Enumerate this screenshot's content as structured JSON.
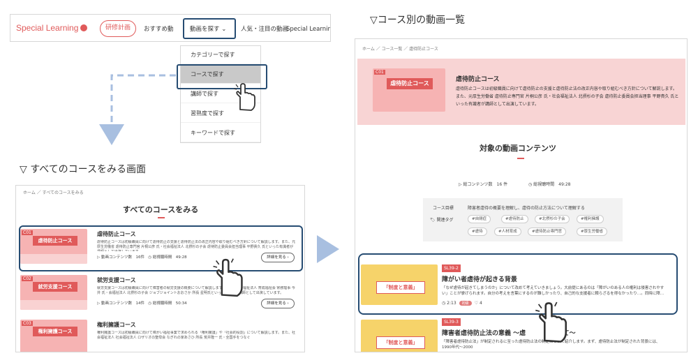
{
  "navbar": {
    "logo": "Special Learning",
    "pill": "研修計画",
    "items": [
      "おすすめ動",
      "動画を探す",
      "人気・注目の動画",
      "Special Learningとし"
    ]
  },
  "dropdown": {
    "items": [
      "カテゴリーで探す",
      "コースで探す",
      "講師で探す",
      "習熟度で探す",
      "キーワードで探す"
    ]
  },
  "headings": {
    "left": "▽ すべてのコースをみる画面",
    "right": "▽コース別の動画一覧"
  },
  "course_list": {
    "breadcrumb": "ホーム ／ すべてのコースをみる",
    "title": "すべてのコースをみる",
    "detail_label": "詳細を見る ›",
    "cards": [
      {
        "code": "C01",
        "thumb_title": "虐待防止コース",
        "title": "虐待防止コース",
        "desc": "虐待防止コースは初級職員に向けて虐待防止の支援と虐待防止法の改正内容や取り組むべき方針について解説します。また、元厚生労働省 虐待防止専門官 片桐公彦 氏・社会福祉法人 北摂杉の子会 虐待防止委員会担当理事 平野貴久 氏といった有識者が講師として出演しています。",
        "count": "動画コンテンツ数　16件",
        "time": "総視聴時間　49:28"
      },
      {
        "code": "C02",
        "thumb_title": "就労支援コース",
        "title": "就労支援コース",
        "desc": "就労支援コースは初級職員に向けて障害者の就労支援の概要について解説します。また、社会福祉法人 育成福祉会 常務理事 今井 氏・会福祉法人 北摂杉の子会 ジョブジョイントおおさか 所長 星明氏といった有識者が講師として出演しています。",
        "count": "動画コンテンツ数　14件",
        "time": "総視聴時間　50:34"
      },
      {
        "code": "C03",
        "thumb_title": "権利擁護コース",
        "title": "権利擁護コース",
        "desc": "権利擁護コースは初級職員に向けて障がい福祉事業で求められる「権利擁護」や「社会的役割」について解説します。また、社会福祉法人 社会福祉法人 ロザリオの聖母会 なぎれの家あさひ 所長 荒井隆一 氏・全国手をつなぐ",
        "count": "",
        "time": ""
      }
    ]
  },
  "course_detail": {
    "breadcrumb": "ホーム ／ コース一覧 ／ 虐待防止コース",
    "banner": {
      "code": "C01",
      "thumb_title": "虐待防止コース",
      "title": "虐待防止コース",
      "desc": "虐待防止コースは初級職員に向けて虐待防止の支援と虐待防止法の改正内容や取り組むべき方針について解説します。また、元厚生労働省 虐待防止専門官 片桐公彦 氏・社会福祉法人 北摂杉の子会 虐待防止委員会担当理事 平野貴久 氏といった有識者が講師として出演しています。"
    },
    "section_title": "対象の動画コンテンツ",
    "stats": {
      "count": "総コンテンツ数　16 件",
      "time": "総視聴時間　49:28"
    },
    "goals": {
      "goal_label": "コース目標",
      "goal_text": "障害者虐待の概要を理解し、虐待の防止方法について理解する",
      "tags_label": "関連タグ",
      "tags": [
        "#自閉症",
        "#虐待防止",
        "#北摂杉の子会",
        "#権利擁護",
        "#虐待",
        "#人材育成",
        "#虐待防止専門官",
        "#厚生労働省"
      ]
    },
    "videos": [
      {
        "code": "SL39-2",
        "thumb_text": "「制度と意義」",
        "title": "障がい者虐待が起きる背景",
        "desc": "「なぜ虐待が起きてしまうのか」について改めて考えていきましょう。大前提にあるのは「障がいのある人の権利は侵害されやすい」ことが挙げられます。自分の考えを言葉にするのが難しかったり、自己的な支援者に頼らざるを得なかったり…。同時に障…",
        "time": "2:13",
        "chip": "初級",
        "likes": "4"
      },
      {
        "code": "SL39-3",
        "thumb_text": "「制度と意義」",
        "title": "障害者虐待防止法の意義 〜虐　　　　　えて〜",
        "desc": "「障害者虐待防止法」が制定されるに至った虐待防止法の制定について紹介します。まず、虐待防止法が制定された背景には、1990年代〜2000",
        "time": "",
        "chip": "",
        "likes": ""
      }
    ]
  },
  "colors": {
    "accent": "#e05a5a",
    "highlight": "#264c72",
    "flow": "#a8bfe0"
  }
}
